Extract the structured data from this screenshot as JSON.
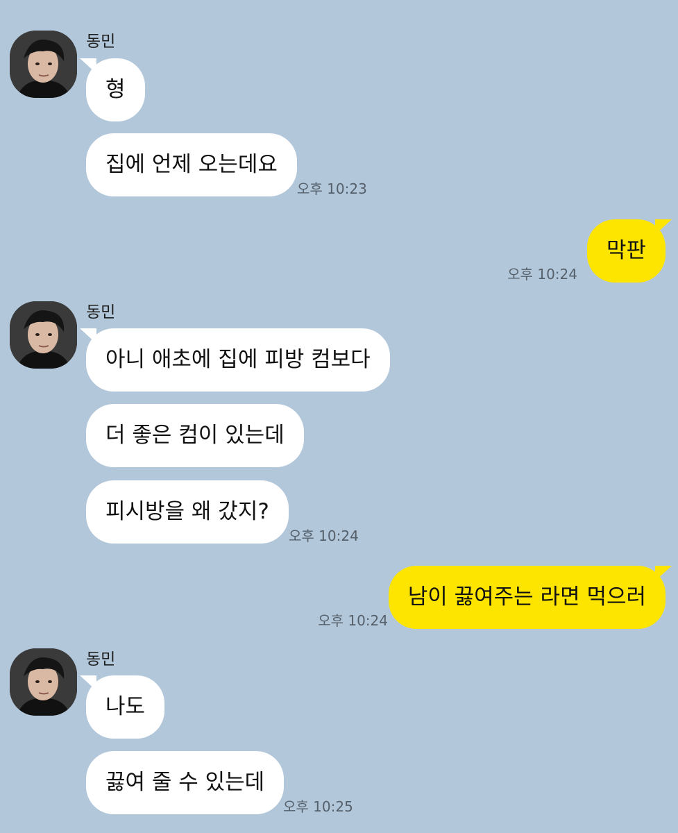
{
  "chat": {
    "groups": [
      {
        "sender": "동민",
        "messages": [
          "형",
          "집에 언제 오는데요"
        ],
        "time": "오후 10:23"
      },
      {
        "outgoing": [
          "막판"
        ],
        "time": "오후 10:24"
      },
      {
        "sender": "동민",
        "messages": [
          "아니 애초에 집에 피방 컴보다",
          "더 좋은 컴이 있는데",
          "피시방을 왜 갔지?"
        ],
        "time": "오후 10:24"
      },
      {
        "outgoing": [
          "남이 끓여주는 라면 먹으러"
        ],
        "time": "오후 10:24"
      },
      {
        "sender": "동민",
        "messages": [
          "나도",
          "끓여 줄 수 있는데"
        ],
        "time": "오후 10:25"
      }
    ]
  },
  "colors": {
    "background": "#b2c7da",
    "incoming_bubble": "#ffffff",
    "outgoing_bubble": "#fee500",
    "timestamp": "#55606b"
  },
  "icons": {
    "avatar": "profile-photo"
  }
}
